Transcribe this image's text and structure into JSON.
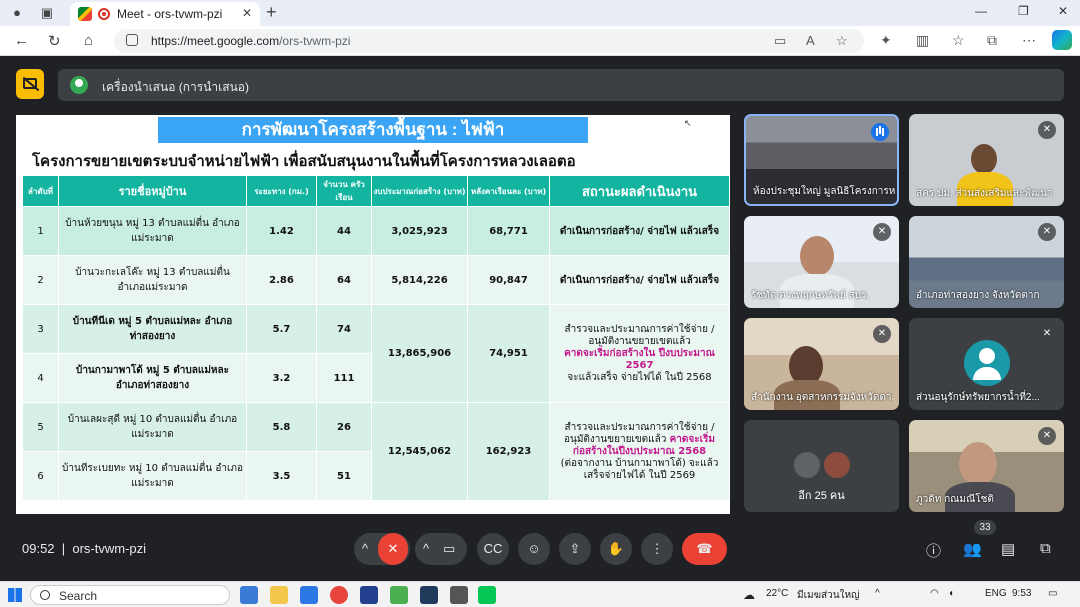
{
  "browser": {
    "tab_title": "Meet - ors-tvwm-pzi",
    "url_host": "https://meet.google.com",
    "url_path": "/ors-tvwm-pzi"
  },
  "meet": {
    "presenting_label": "เครื่องนำเสนอ (การนำเสนอ)",
    "time": "09:52",
    "meeting_code": "ors-tvwm-pzi",
    "participant_count": "33",
    "others_label": "อีก 25 คน"
  },
  "slide": {
    "title": "การพัฒนาโครงสร้างพื้นฐาน :  ไฟฟ้า",
    "subtitle": "โครงการขยายเขตระบบจำหน่ายไฟฟ้า เพื่อสนับสนุนงานในพื้นที่โครงการหลวงเลอตอ",
    "headers": [
      "ลำดับที่",
      "รายชื่อหมู่บ้าน",
      "ระยะทาง (กม.)",
      "จำนวน ครัวเรือน",
      "งบประมาณก่อสร้าง (บาท)",
      "หลังคาเรือนละ (บาท)",
      "สถานะผลดำเนินงาน"
    ],
    "rows": [
      {
        "no": "1",
        "village": "บ้านห้วยขนุน หมู่ 13 ตำบลแม่ตื่น อำเภอแม่ระมาด",
        "distance": "1.42",
        "households": "44",
        "budget": "3,025,923",
        "per_house": "68,771",
        "status": "ดำเนินการก่อสร้าง/ จ่ายไฟ แล้วเสร็จ"
      },
      {
        "no": "2",
        "village": "บ้านวะกะเลโค๊ะ หมู่ 13 ตำบลแม่ตื่น อำเภอแม่ระมาด",
        "distance": "2.86",
        "households": "64",
        "budget": "5,814,226",
        "per_house": "90,847",
        "status": "ดำเนินการก่อสร้าง/ จ่ายไฟ แล้วเสร็จ"
      },
      {
        "no": "3",
        "village": "บ้านทีนีเด หมู่ 5 ตำบลแม่หละ อำเภอท่าสองยาง",
        "distance": "5.7",
        "households": "74"
      },
      {
        "no": "4",
        "village": "บ้านกามาพาโด้ หมู่ 5 ตำบลแม่หละ อำเภอท่าสองยาง",
        "distance": "3.2",
        "households": "111"
      },
      {
        "no": "5",
        "village": "บ้านเลผะสุดี หมู่ 10 ตำบลแม่ตื่น อำเภอแม่ระมาด",
        "distance": "5.8",
        "households": "26"
      },
      {
        "no": "6",
        "village": "บ้านทีระเบยทะ หมู่ 10 ตำบลแม่ตื่น อำเภอแม่ระมาด",
        "distance": "3.5",
        "households": "51"
      }
    ],
    "group_a": {
      "budget": "13,865,906",
      "per_house": "74,951",
      "status_1": "สำรวจและประมาณการค่าใช้จ่าย / อนุมัติงานขยายเขตแล้ว",
      "status_2": "คาดจะเริ่มก่อสร้างใน ปีงบประมาณ 2567",
      "status_3": "จะแล้วเสร็จ จ่ายไฟได้ ในปี 2568"
    },
    "group_b": {
      "budget": "12,545,062",
      "per_house": "162,923",
      "status_1": "สำรวจและประมาณการค่าใช้จ่าย / อนุมัติงานขยายเขตแล้ว",
      "status_2": "คาดจะเริ่ม ก่อสร้างในปีงบประมาณ 2568",
      "status_3": "(ต่อจากงาน บ้านกามาพาโด้) จะแล้วเสร็จจ่ายไฟได้ ในปี 2569"
    }
  },
  "participants": [
    {
      "name": "ห้องประชุมใหญ่ มูลนิธิโครงการหลวง"
    },
    {
      "name": "สคร.ปม. ส่วนส่งเสริมและพัฒนา"
    },
    {
      "name": "รัชทัต ตวงพฤกษทรัพย์ สบร."
    },
    {
      "name": "อำเภอท่าสองยาง จังหวัดตาก"
    },
    {
      "name": "สำนักงาน อุตสาหกรรมจังหวัดตาก"
    },
    {
      "name": "ส่วนอนุรักษ์ทรัพยากรน้ำที่2..."
    },
    {
      "name": "ภูวดิท กณมณีโชติ"
    }
  ],
  "taskbar": {
    "search": "Search",
    "weather": "22°C",
    "weather_desc": "มีเมฆส่วนใหญ่",
    "lang": "ENG",
    "clock": "9:53"
  }
}
